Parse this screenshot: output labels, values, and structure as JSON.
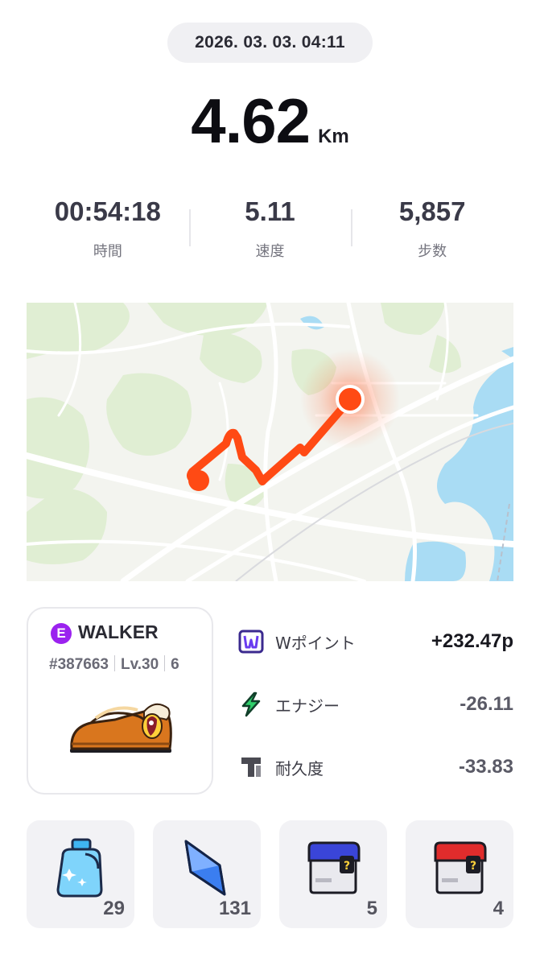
{
  "header": {
    "datetime": "2026. 03. 03. 04:11"
  },
  "distance": {
    "value": "4.62",
    "unit": "Km"
  },
  "stats": [
    {
      "value": "00:54:18",
      "label": "時間"
    },
    {
      "value": "5.11",
      "label": "速度"
    },
    {
      "value": "5,857",
      "label": "步数"
    }
  ],
  "map": {
    "route_color": "#ff4a14",
    "water_color": "#a8dcf5",
    "park_color": "#dfeed2"
  },
  "shoe": {
    "rarity_badge": "E",
    "name": "WALKER",
    "id": "#387663",
    "level": "Lv.30",
    "extra": "6"
  },
  "results": [
    {
      "icon": "w-point-icon",
      "label": "Wポイント",
      "value": "+232.47p"
    },
    {
      "icon": "energy-icon",
      "label": "エナジー",
      "value": "-26.11"
    },
    {
      "icon": "durability-icon",
      "label": "耐久度",
      "value": "-33.83"
    }
  ],
  "items": [
    {
      "icon": "detergent-bottle-icon",
      "count": "29"
    },
    {
      "icon": "blue-gem-icon",
      "count": "131"
    },
    {
      "icon": "blue-mystery-box-icon",
      "count": "5"
    },
    {
      "icon": "red-mystery-box-icon",
      "count": "4"
    }
  ],
  "colors": {
    "accent_purple": "#9b22ef",
    "energy_green": "#2fcf6a",
    "route": "#ff4a14"
  }
}
